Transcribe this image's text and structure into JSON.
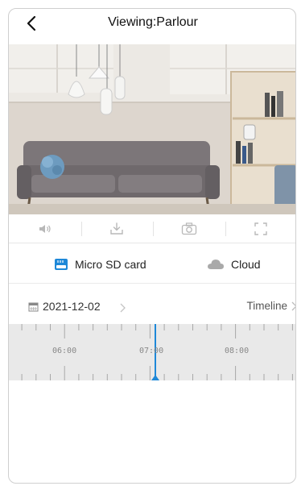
{
  "header": {
    "title": "Viewing:Parlour"
  },
  "icons": {
    "back": "chevron-left-icon",
    "volume": "volume-icon",
    "download": "download-icon",
    "snapshot": "camera-icon",
    "fullscreen": "fullscreen-icon",
    "sd": "sd-card-icon",
    "cloud": "cloud-icon",
    "calendar": "calendar-icon"
  },
  "sources": {
    "sd_label": "Micro SD card",
    "cloud_label": "Cloud"
  },
  "playback": {
    "date": "2021-12-02",
    "timeline_label": "Timeline"
  },
  "timeline": {
    "labels": [
      "06:00",
      "07:00",
      "08:00"
    ]
  },
  "colors": {
    "accent": "#1e88d8",
    "timeline_bg": "#e9e9e9"
  }
}
